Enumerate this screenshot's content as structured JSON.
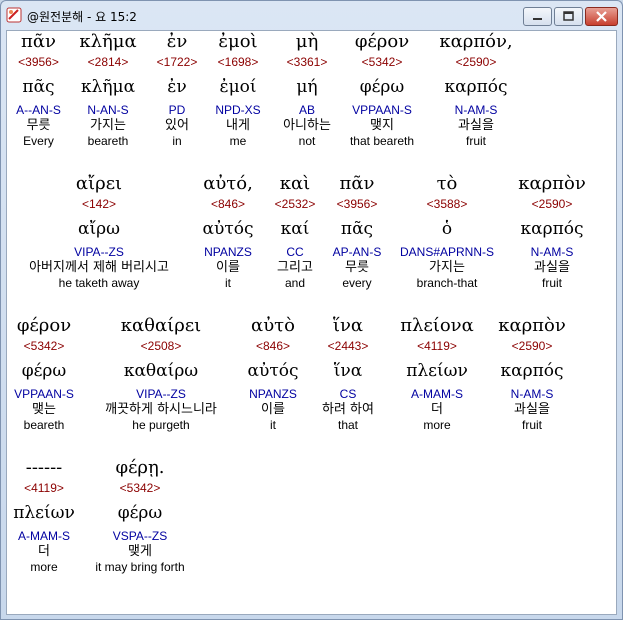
{
  "window": {
    "title": "@원전분해 - 요 15:2"
  },
  "words": [
    {
      "greek": "πᾶν",
      "strong": "<3956>",
      "lemma": "πᾶς",
      "parse": "A--AN-S",
      "korean": "무릇",
      "english": "Every"
    },
    {
      "greek": "κλῆμα",
      "strong": "<2814>",
      "lemma": "κλῆμα",
      "parse": "N-AN-S",
      "korean": "가지는",
      "english": "beareth"
    },
    {
      "greek": "ἐν",
      "strong": "<1722>",
      "lemma": "ἐν",
      "parse": "PD",
      "korean": "있어",
      "english": "in"
    },
    {
      "greek": "ἐμοὶ",
      "strong": "<1698>",
      "lemma": "ἐμοί",
      "parse": "NPD-XS",
      "korean": "내게",
      "english": "me"
    },
    {
      "greek": "μὴ",
      "strong": "<3361>",
      "lemma": "μή",
      "parse": "AB",
      "korean": "아니하는",
      "english": "not"
    },
    {
      "greek": "φέρον",
      "strong": "<5342>",
      "lemma": "φέρω",
      "parse": "VPPAAN-S",
      "korean": "맺지",
      "english": "that beareth"
    },
    {
      "greek": "καρπόν,",
      "strong": "<2590>",
      "lemma": "καρπός",
      "parse": "N-AM-S",
      "korean": "과실을",
      "english": "fruit"
    },
    {
      "greek": "αἴρει",
      "strong": "<142>",
      "lemma": "αἴρω",
      "parse": "VIPA--ZS",
      "korean": "아버지께서 제해 버리시고",
      "english": "he taketh away"
    },
    {
      "greek": "αὐτό,",
      "strong": "<846>",
      "lemma": "αὐτός",
      "parse": "NPANZS",
      "korean": "이를",
      "english": "it"
    },
    {
      "greek": "καὶ",
      "strong": "<2532>",
      "lemma": "καί",
      "parse": "CC",
      "korean": "그리고",
      "english": "and"
    },
    {
      "greek": "πᾶν",
      "strong": "<3956>",
      "lemma": "πᾶς",
      "parse": "AP-AN-S",
      "korean": "무릇",
      "english": "every"
    },
    {
      "greek": "τὸ",
      "strong": "<3588>",
      "lemma": "ὁ",
      "parse": "DANS#APRNN-S",
      "korean": "가지는",
      "english": "branch-that"
    },
    {
      "greek": "καρπὸν",
      "strong": "<2590>",
      "lemma": "καρπός",
      "parse": "N-AM-S",
      "korean": "과실을",
      "english": "fruit"
    },
    {
      "greek": "φέρον",
      "strong": "<5342>",
      "lemma": "φέρω",
      "parse": "VPPAAN-S",
      "korean": "맺는",
      "english": "beareth"
    },
    {
      "greek": "καθαίρει",
      "strong": "<2508>",
      "lemma": "καθαίρω",
      "parse": "VIPA--ZS",
      "korean": "깨끗하게 하시느니라",
      "english": "he purgeth"
    },
    {
      "greek": "αὐτὸ",
      "strong": "<846>",
      "lemma": "αὐτός",
      "parse": "NPANZS",
      "korean": "이를",
      "english": "it"
    },
    {
      "greek": "ἵνα",
      "strong": "<2443>",
      "lemma": "ἵνα",
      "parse": "CS",
      "korean": "하려 하여",
      "english": "that"
    },
    {
      "greek": "πλείονα",
      "strong": "<4119>",
      "lemma": "πλείων",
      "parse": "A-MAM-S",
      "korean": "더",
      "english": "more"
    },
    {
      "greek": "καρπὸν",
      "strong": "<2590>",
      "lemma": "καρπός",
      "parse": "N-AM-S",
      "korean": "과실을",
      "english": "fruit"
    },
    {
      "greek": "------",
      "strong": "<4119>",
      "lemma": "πλείων",
      "parse": "A-MAM-S",
      "korean": "더",
      "english": "more"
    },
    {
      "greek": "φέρῃ.",
      "strong": "<5342>",
      "lemma": "φέρω",
      "parse": "VSPA--ZS",
      "korean": "맺게",
      "english": "it may bring forth"
    }
  ]
}
